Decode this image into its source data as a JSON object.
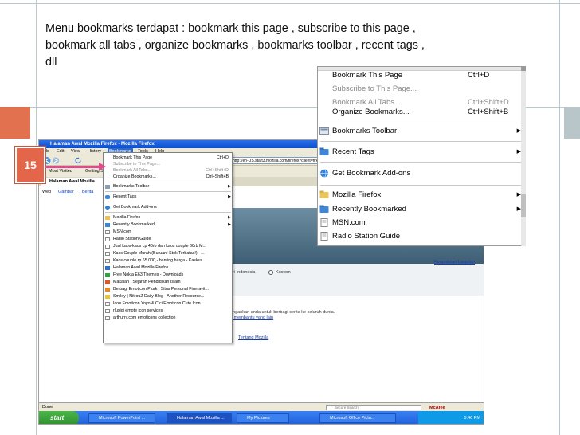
{
  "slide": {
    "line1": "Menu bookmarks terdapat : bookmark this page , subscribe to this page ,",
    "line2": "bookmark all tabs , organize bookmarks , bookmarks toolbar , recent tags ,",
    "line3": "dll",
    "badge_number": "15",
    "colors": {
      "accent": "#e2714f",
      "arrow": "#e8468a",
      "deco": "#b7c9cc"
    }
  },
  "browser": {
    "window_title": "Halaman Awal Mozilla Firefox - Mozilla Firefox",
    "menu": [
      "File",
      "Edit",
      "View",
      "History",
      "Bookmarks",
      "Tools",
      "Help"
    ],
    "url": "http://en-US.start3.mozilla.com/firefox?client=firefox-a&rls=org.mozilla:en-US:official",
    "bookmarks_toolbar": [
      "Most Visited",
      "Getting St..."
    ],
    "tab_label": "Halaman Awal Mozilla",
    "search_links": [
      "Web",
      "Gambar",
      "Berita"
    ],
    "content": {
      "link_right": "Pengaturan Lanjutan",
      "radio_label": "Kustom",
      "partial_text": "ari Indonesia",
      "text1": "angankan anda untuk berbagi cerita ke seluruh dunia.",
      "link_help": "u membantu yang lain",
      "link_about": "Tentang Mozilla"
    },
    "status": {
      "text": "Done",
      "search_placeholder": "Secure Search",
      "mcafee": "McAfee"
    },
    "taskbar": {
      "start": "start",
      "items": [
        "Microsoft PowerPoint ...",
        "Halaman Awal Mozilla ...",
        "My Pictures",
        "Microsoft Office Pictu..."
      ],
      "clock": "5:46 PM"
    }
  },
  "small_menu": {
    "items": [
      {
        "label": "Bookmark This Page",
        "shortcut": "Ctrl+D",
        "gray": false
      },
      {
        "label": "Subscribe to This Page...",
        "shortcut": "",
        "gray": true
      },
      {
        "label": "Bookmark All Tabs...",
        "shortcut": "Ctrl+Shift+D",
        "gray": true
      },
      {
        "label": "Organize Bookmarks...",
        "shortcut": "Ctrl+Shift+B",
        "gray": false
      },
      {
        "label": "Bookmarks Toolbar",
        "shortcut": "",
        "gray": false
      },
      {
        "label": "Recent Tags",
        "shortcut": "",
        "gray": false
      },
      {
        "label": "Get Bookmark Add-ons",
        "shortcut": "",
        "gray": false
      },
      {
        "label": "Mozilla Firefox",
        "shortcut": "",
        "gray": false
      },
      {
        "label": "Recently Bookmarked",
        "shortcut": "",
        "gray": false
      },
      {
        "label": "MSN.com",
        "shortcut": "",
        "gray": false
      },
      {
        "label": "Radio Station Guide",
        "shortcut": "",
        "gray": false
      },
      {
        "label": "Jual kaos-kaos cp 40rb dan kaos couple 60rb M...",
        "shortcut": "",
        "gray": false
      },
      {
        "label": "Kaos Couple Murah (Buruan! Stok Terbatas!) - ...",
        "shortcut": "",
        "gray": false
      },
      {
        "label": "Kaos couple rp 65.000,- banting harga - Kaskus...",
        "shortcut": "",
        "gray": false
      },
      {
        "label": "Halaman Awal Mozilla Firefox",
        "shortcut": "",
        "gray": false
      },
      {
        "label": "Free Nokia E63 Themes - Downloads",
        "shortcut": "",
        "gray": false
      },
      {
        "label": "Makalah : Sejarah Pendidikan Islam",
        "shortcut": "",
        "gray": false
      },
      {
        "label": "Berbagi Emoticon Plurk | Situs Personal Firenavit...",
        "shortcut": "",
        "gray": false
      },
      {
        "label": "Smiley | NitrouZ Daily Blog - Another Resource...",
        "shortcut": "",
        "gray": false
      },
      {
        "label": "Icon Emoticon Yoyo & Cici Emoticon Cute Icon...",
        "shortcut": "",
        "gray": false
      },
      {
        "label": "rluxigi emote icon services",
        "shortcut": "",
        "gray": false
      },
      {
        "label": "arthurry.com emoticons collection",
        "shortcut": "",
        "gray": false
      }
    ]
  },
  "big_menu": {
    "items": [
      {
        "label": "Bookmark This Page",
        "shortcut": "Ctrl+D"
      },
      {
        "label": "Subscribe to This Page...",
        "shortcut": ""
      },
      {
        "label": "Bookmark All Tabs...",
        "shortcut": "Ctrl+Shift+D"
      },
      {
        "label": "Organize Bookmarks...",
        "shortcut": "Ctrl+Shift+B"
      },
      {
        "label": "Bookmarks Toolbar",
        "shortcut": ""
      },
      {
        "label": "Recent Tags",
        "shortcut": ""
      },
      {
        "label": "Get Bookmark Add-ons",
        "shortcut": ""
      },
      {
        "label": "Mozilla Firefox",
        "shortcut": ""
      },
      {
        "label": "Recently Bookmarked",
        "shortcut": ""
      },
      {
        "label": "MSN.com",
        "shortcut": ""
      },
      {
        "label": "Radio Station Guide",
        "shortcut": ""
      }
    ]
  }
}
